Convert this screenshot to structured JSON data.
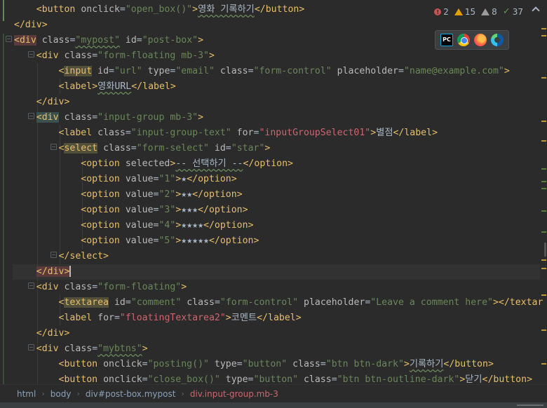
{
  "inspections": {
    "errors": "2",
    "warnings": "15",
    "weak_warnings": "8",
    "ok": "37"
  },
  "browsers": [
    {
      "name": "PyCharm",
      "icon": "pycharm-icon",
      "label": "PC"
    },
    {
      "name": "Chrome",
      "icon": "chrome-icon"
    },
    {
      "name": "Firefox",
      "icon": "firefox-icon"
    },
    {
      "name": "Edge",
      "icon": "edge-icon"
    }
  ],
  "code": {
    "l1": {
      "pre": "    <",
      "tag": "button",
      "attr": "onclick",
      "val": "\"open_box()\"",
      "text": "영화 기록하기",
      "close": "</button>"
    },
    "l2": "</div>",
    "l3": {
      "tag": "div",
      "class_attr": "class",
      "class_val": "\"mypost\"",
      "id_attr": "id",
      "id_val": "\"post-box\""
    },
    "l4": {
      "tag": "div",
      "attr": "class",
      "val": "\"form-floating mb-3\""
    },
    "l5": {
      "tag": "input",
      "a1": "id",
      "v1": "\"url\"",
      "a2": "type",
      "v2": "\"email\"",
      "a3": "class",
      "v3": "\"form-control\"",
      "a4": "placeholder",
      "v4": "\"name@example.com\""
    },
    "l6": {
      "tag": "label",
      "text": "영화URL",
      "close": "label"
    },
    "l7": "</div>",
    "l8": {
      "tag": "div",
      "attr": "class",
      "val": "\"input-group mb-3\""
    },
    "l9": {
      "tag": "label",
      "a1": "class",
      "v1": "\"input-group-text\"",
      "a2": "for",
      "v2": "\"inputGroupSelect01\"",
      "text": "별점",
      "close": "label"
    },
    "l10": {
      "tag": "select",
      "a1": "class",
      "v1": "\"form-select\"",
      "a2": "id",
      "v2": "\"star\""
    },
    "l11": {
      "tag": "option",
      "attr": "selected",
      "text": "-- 선택하기 --",
      "close": "option"
    },
    "options": [
      {
        "attr": "value",
        "val": "\"1\"",
        "text": "★"
      },
      {
        "attr": "value",
        "val": "\"2\"",
        "text": "★★"
      },
      {
        "attr": "value",
        "val": "\"3\"",
        "text": "★★★"
      },
      {
        "attr": "value",
        "val": "\"4\"",
        "text": "★★★★"
      },
      {
        "attr": "value",
        "val": "\"5\"",
        "text": "★★★★★"
      }
    ],
    "l17": "</select>",
    "l18": "</div>",
    "l19": {
      "tag": "div",
      "attr": "class",
      "val": "\"form-floating\""
    },
    "l20": {
      "tag": "textarea",
      "a1": "id",
      "v1": "\"comment\"",
      "a2": "class",
      "v2": "\"form-control\"",
      "a3": "placeholder",
      "v3": "\"Leave a comment here\"",
      "tail": "></textar"
    },
    "l21": {
      "tag": "label",
      "a1": "for",
      "v1": "\"floatingTextarea2\"",
      "text": "코멘트",
      "close": "label"
    },
    "l22": "</div>",
    "l23": {
      "tag": "div",
      "attr": "class",
      "val": "\"mybtns\""
    },
    "l24": {
      "tag": "button",
      "a1": "onclick",
      "v1": "\"posting()\"",
      "a2": "type",
      "v2": "\"button\"",
      "a3": "class",
      "v3": "\"btn btn-dark\"",
      "text": "기록하기",
      "close": "button"
    },
    "l25": {
      "tag": "button",
      "a1": "onclick",
      "v1": "\"close_box()\"",
      "a2": "type",
      "v2": "\"button\"",
      "a3": "class",
      "v3": "\"btn btn-outline-dark\"",
      "text": "닫기",
      "close": "button"
    }
  },
  "breadcrumb": [
    "html",
    "body",
    "div#post-box.mypost",
    "div.input-group.mb-3"
  ]
}
